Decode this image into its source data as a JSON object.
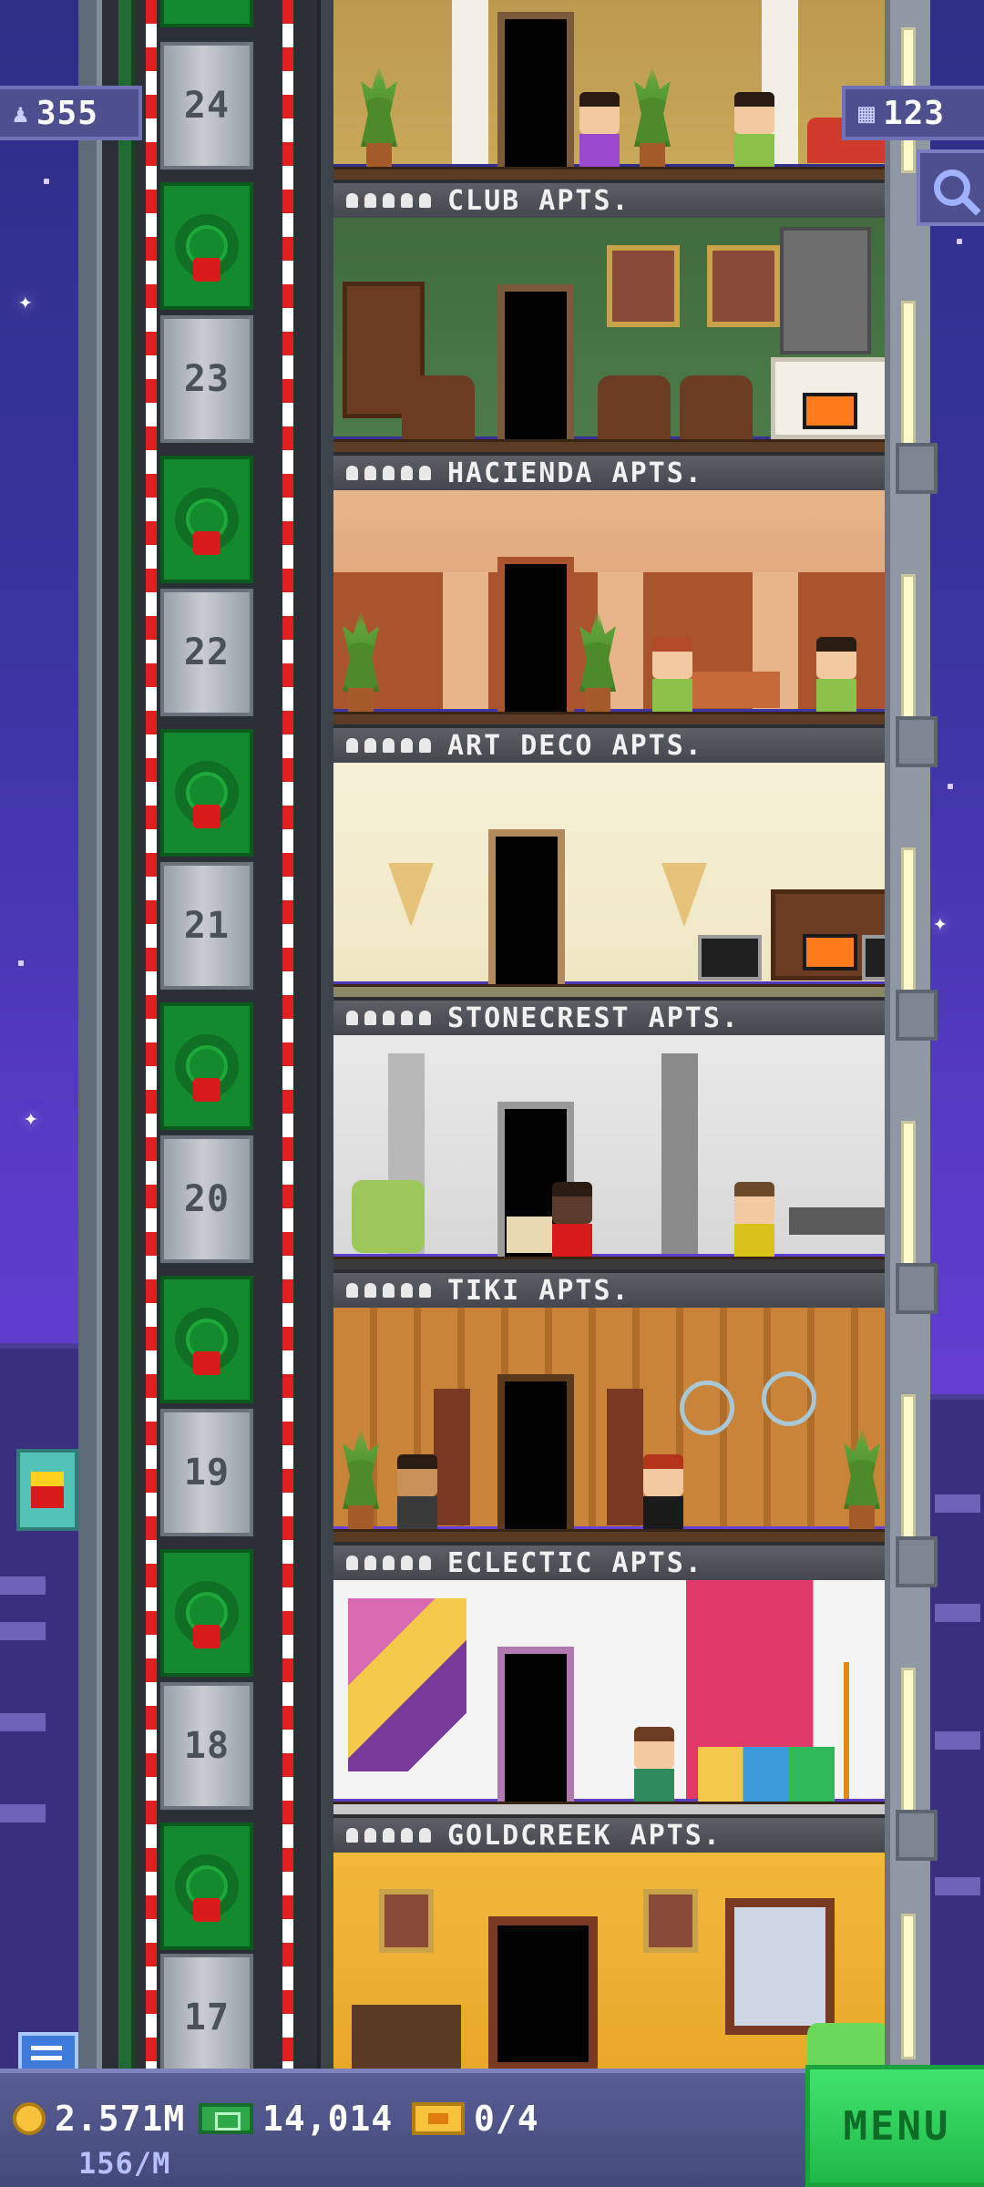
{
  "hud": {
    "population": "355",
    "floors": "123"
  },
  "floors": [
    {
      "number": "24",
      "name": "CLUB APTS."
    },
    {
      "number": "23",
      "name": "HACIENDA APTS."
    },
    {
      "number": "22",
      "name": "ART DECO APTS."
    },
    {
      "number": "21",
      "name": "STONECREST APTS."
    },
    {
      "number": "20",
      "name": "TIKI APTS."
    },
    {
      "number": "19",
      "name": "ECLECTIC APTS."
    },
    {
      "number": "18",
      "name": "GOLDCREEK APTS."
    },
    {
      "number": "17",
      "name": ""
    }
  ],
  "bottom": {
    "coins": "2.571M",
    "coins_rate": "156/M",
    "bux": "14,014",
    "tickets": "0/4",
    "menu_label": "MENU"
  },
  "colors": {
    "sky_top": "#2d2f86",
    "sky_mid": "#6a3fd6",
    "menu_green": "#3fe46c",
    "coin_gold": "#f6c33a",
    "bux_green": "#2ea84a",
    "elevator_red": "#e02020"
  },
  "icons": [
    "person-icon",
    "building-icon",
    "search-icon",
    "fries-icon",
    "chat-icon",
    "coin-icon",
    "bux-icon",
    "ticket-icon",
    "wreath-icon"
  ]
}
